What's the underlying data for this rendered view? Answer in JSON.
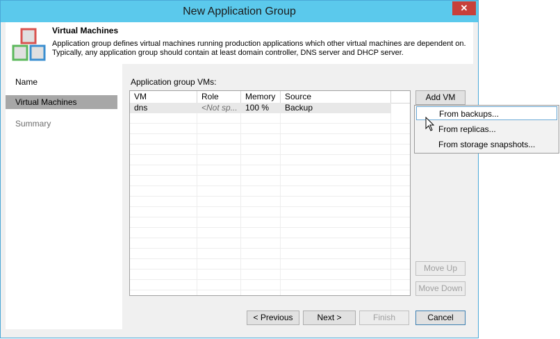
{
  "window": {
    "title": "New Application Group",
    "close_glyph": "✕"
  },
  "header": {
    "title": "Virtual Machines",
    "description_line1": "Application group defines virtual machines running production applications which other virtual machines are dependent on.",
    "description_line2": "Typically, any application group should contain at least domain controller, DNS server and DHCP server.",
    "icon": "application-group-icon"
  },
  "sidebar": {
    "items": [
      {
        "label": "Name",
        "state": "normal"
      },
      {
        "label": "Virtual Machines",
        "state": "active"
      },
      {
        "label": "Summary",
        "state": "disabled"
      }
    ]
  },
  "content": {
    "vms_label": "Application group VMs:",
    "table": {
      "columns": [
        "VM",
        "Role",
        "Memory",
        "Source"
      ],
      "rows": [
        {
          "vm": "dns",
          "role": "<Not sp...",
          "memory": "100 %",
          "source": "Backup"
        }
      ]
    },
    "buttons": {
      "add_vm": "Add VM",
      "move_up": "Move Up",
      "move_down": "Move Down"
    }
  },
  "add_vm_menu": {
    "items": [
      "From backups...",
      "From replicas...",
      "From storage snapshots..."
    ]
  },
  "footer": {
    "previous": "< Previous",
    "next": "Next >",
    "finish": "Finish",
    "cancel": "Cancel"
  }
}
